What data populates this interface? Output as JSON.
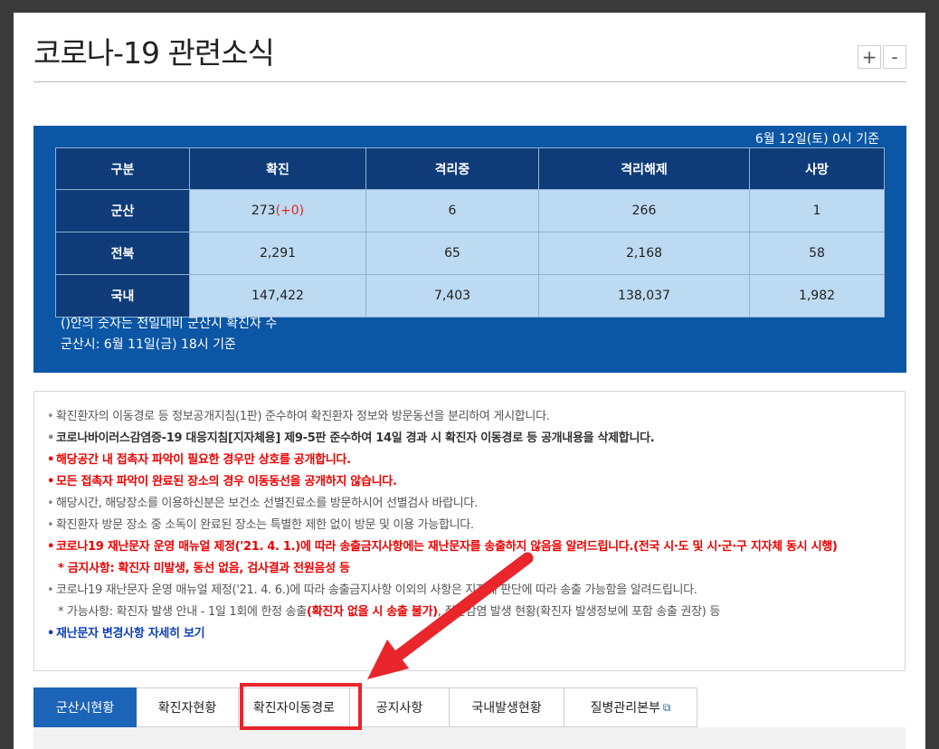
{
  "title": "코로나-19 관련소식",
  "zoom": {
    "plus": "+",
    "minus": "-"
  },
  "stats": {
    "date": "6월 12일(토) 0시 기준",
    "headers": [
      "구분",
      "확진",
      "격리중",
      "격리해제",
      "사망"
    ],
    "rows": [
      {
        "region": "군산",
        "confirmed": "273",
        "delta": "(+0)",
        "isolated": "6",
        "released": "266",
        "deaths": "1"
      },
      {
        "region": "전북",
        "confirmed": "2,291",
        "delta": "",
        "isolated": "65",
        "released": "2,168",
        "deaths": "58"
      },
      {
        "region": "국내",
        "confirmed": "147,422",
        "delta": "",
        "isolated": "7,403",
        "released": "138,037",
        "deaths": "1,982"
      }
    ],
    "note1": "()안의 숫자는 전일대비 군산시 확진자 수",
    "note2": "군산시: 6월 11일(금) 18시 기준"
  },
  "notices": {
    "n1": "확진환자의 이동경로 등 정보공개지침(1판) 준수하여 확진환자 정보와 방문동선을 분리하여 게시합니다.",
    "n2": "코로나바이러스감염증-19 대응지침[지자체용] 제9-5판 준수하여 14일 경과 시 확진자 이동경로 등 공개내용을 삭제합니다.",
    "n3": "해당공간 내 접촉자 파악이 필요한 경우만 상호를 공개합니다.",
    "n4": "모든 접촉자 파악이 완료된 장소의 경우 이동동선을 공개하지 않습니다.",
    "n5": "해당시간, 해당장소를 이용하신분은 보건소 선별진료소를 방문하시어 선별검사 바랍니다.",
    "n6": "확진환자 방문 장소 중 소독이 완료된 장소는 특별한 제한 없이 방문 및 이용 가능합니다.",
    "n7": "코로나19 재난문자 운영 매뉴얼 제정('21. 4. 1.)에 따라 송출금지사항에는 재난문자를 송출하지 않음을 알려드립니다.(전국 시·도 및 시·군·구 지자체 동시 시행)",
    "n7sub": "* 금지사항: 확진자 미발생, 동선 없음, 검사결과 전원음성 등",
    "n8": "코로나19 재난문자 운영 매뉴얼 제정('21. 4. 6.)에 따라 송출금지사항 이외의 사항은 지자체 판단에 따라 송출 가능함을 알려드립니다.",
    "n8sub_a": "* 가능사항: 확진자 발생 안내 - 1일 1회에 한정 송출",
    "n8sub_b": "(확진자 없을 시 송출 불가)",
    "n8sub_c": ", 집단감염 발생 현황(확진자 발생정보에 포함 송출 권장) 등",
    "n9": "재난문자 변경사항 자세히 보기"
  },
  "tabs": [
    {
      "label": "군산시현황"
    },
    {
      "label": "확진자현황"
    },
    {
      "label": "확진자이동경로"
    },
    {
      "label": "공지사항"
    },
    {
      "label": "국내발생현황"
    },
    {
      "label": "질병관리본부"
    }
  ],
  "icons": {
    "external": "external-link-icon"
  },
  "colors": {
    "accent": "#0b56a5",
    "header": "#0f3c78",
    "cell": "#bcdaf1",
    "highlight": "#e8262b",
    "tab_active": "#1c64b8"
  }
}
